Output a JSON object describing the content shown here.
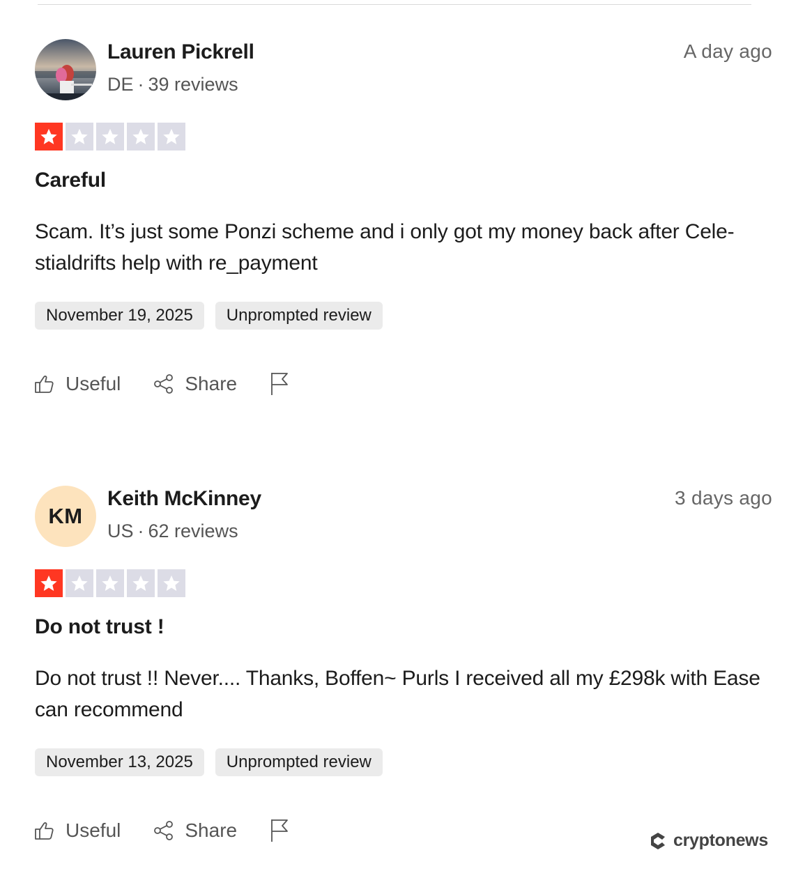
{
  "reviews": [
    {
      "name": "Lauren Pickrell",
      "country": "DE",
      "review_count": "39 reviews",
      "time_ago": "A day ago",
      "rating": 1,
      "title": "Careful",
      "body": "Scam. It’s just some Ponzi scheme and i only got my money back after Cele-stialdrifts help with re_payment",
      "date": "November 19, 2025",
      "label": "Unprompted review",
      "avatar_type": "photo"
    },
    {
      "name": "Keith McKinney",
      "initials": "KM",
      "country": "US",
      "review_count": "62 reviews",
      "time_ago": "3 days ago",
      "rating": 1,
      "title": "Do not trust !",
      "body": "Do not trust !! Never.... Thanks, Boffen~ Purls I received all my £298k with Ease can recommend",
      "date": "November 13, 2025",
      "label": "Unprompted review",
      "avatar_type": "initials",
      "avatar_color": "#fde3bd"
    }
  ],
  "actions": {
    "useful_label": "Useful",
    "share_label": "Share"
  },
  "colors": {
    "star_filled": "#ff3722",
    "star_empty": "#dcdce6",
    "chip_bg": "#ebebeb"
  },
  "icons": [
    "thumbs-up-icon",
    "share-icon",
    "flag-icon",
    "star-icon"
  ],
  "watermark": {
    "text": "cryptonews"
  }
}
